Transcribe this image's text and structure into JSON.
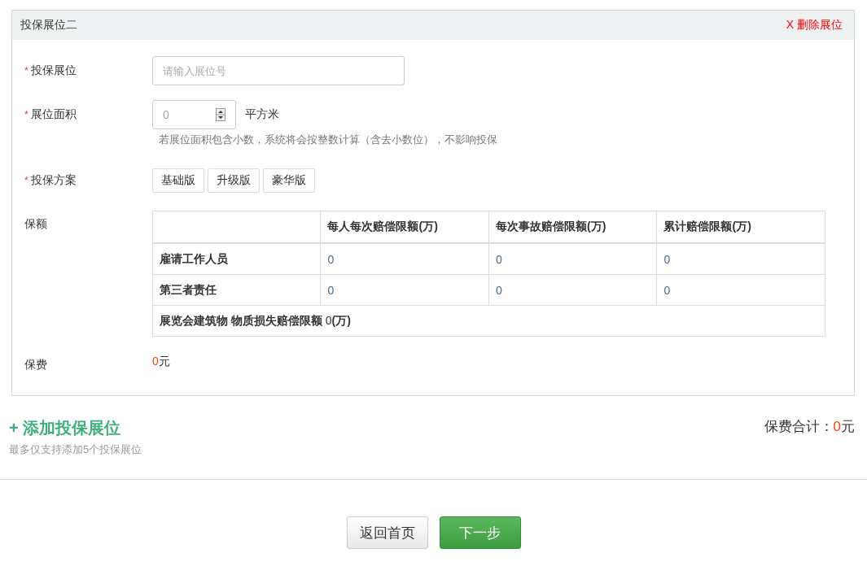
{
  "panel": {
    "title": "投保展位二",
    "delete_link": "X 删除展位"
  },
  "form": {
    "booth": {
      "required_mark": "*",
      "label": "投保展位",
      "placeholder": "请输入展位号"
    },
    "area": {
      "required_mark": "*",
      "label": "展位面积",
      "value": "0",
      "unit": "平方米",
      "hint": "若展位面积包含小数，系统将会按整数计算（含去小数位），不影响投保"
    },
    "plan": {
      "required_mark": "*",
      "label": "投保方案",
      "options": [
        {
          "label": "基础版",
          "selected": false
        },
        {
          "label": "升级版",
          "selected": false
        },
        {
          "label": "豪华版",
          "selected": false
        }
      ]
    },
    "coverage": {
      "label": "保额",
      "table": {
        "columns": [
          "",
          "每人每次赔偿限额(万)",
          "每次事故赔偿限额(万)",
          "累计赔偿限额(万)"
        ],
        "rows": [
          {
            "name": "雇请工作人员",
            "values": [
              "0",
              "0",
              "0"
            ]
          },
          {
            "name": "第三者责任",
            "values": [
              "0",
              "0",
              "0"
            ]
          }
        ],
        "footer": "**展览会建筑物 物质损失赔偿限额** 0**(万)**"
      }
    },
    "fee": {
      "label": "保费",
      "amount": "0",
      "unit": "元"
    }
  },
  "add_link": "+ 添加投保展位",
  "add_hint": "最多仅支持添加5个投保展位",
  "total": {
    "label": "保费合计：",
    "amount": "0",
    "unit": "元"
  },
  "buttons": [
    {
      "label": "返回首页",
      "kind": "default"
    },
    {
      "label": "下一步",
      "kind": "primary"
    }
  ]
}
